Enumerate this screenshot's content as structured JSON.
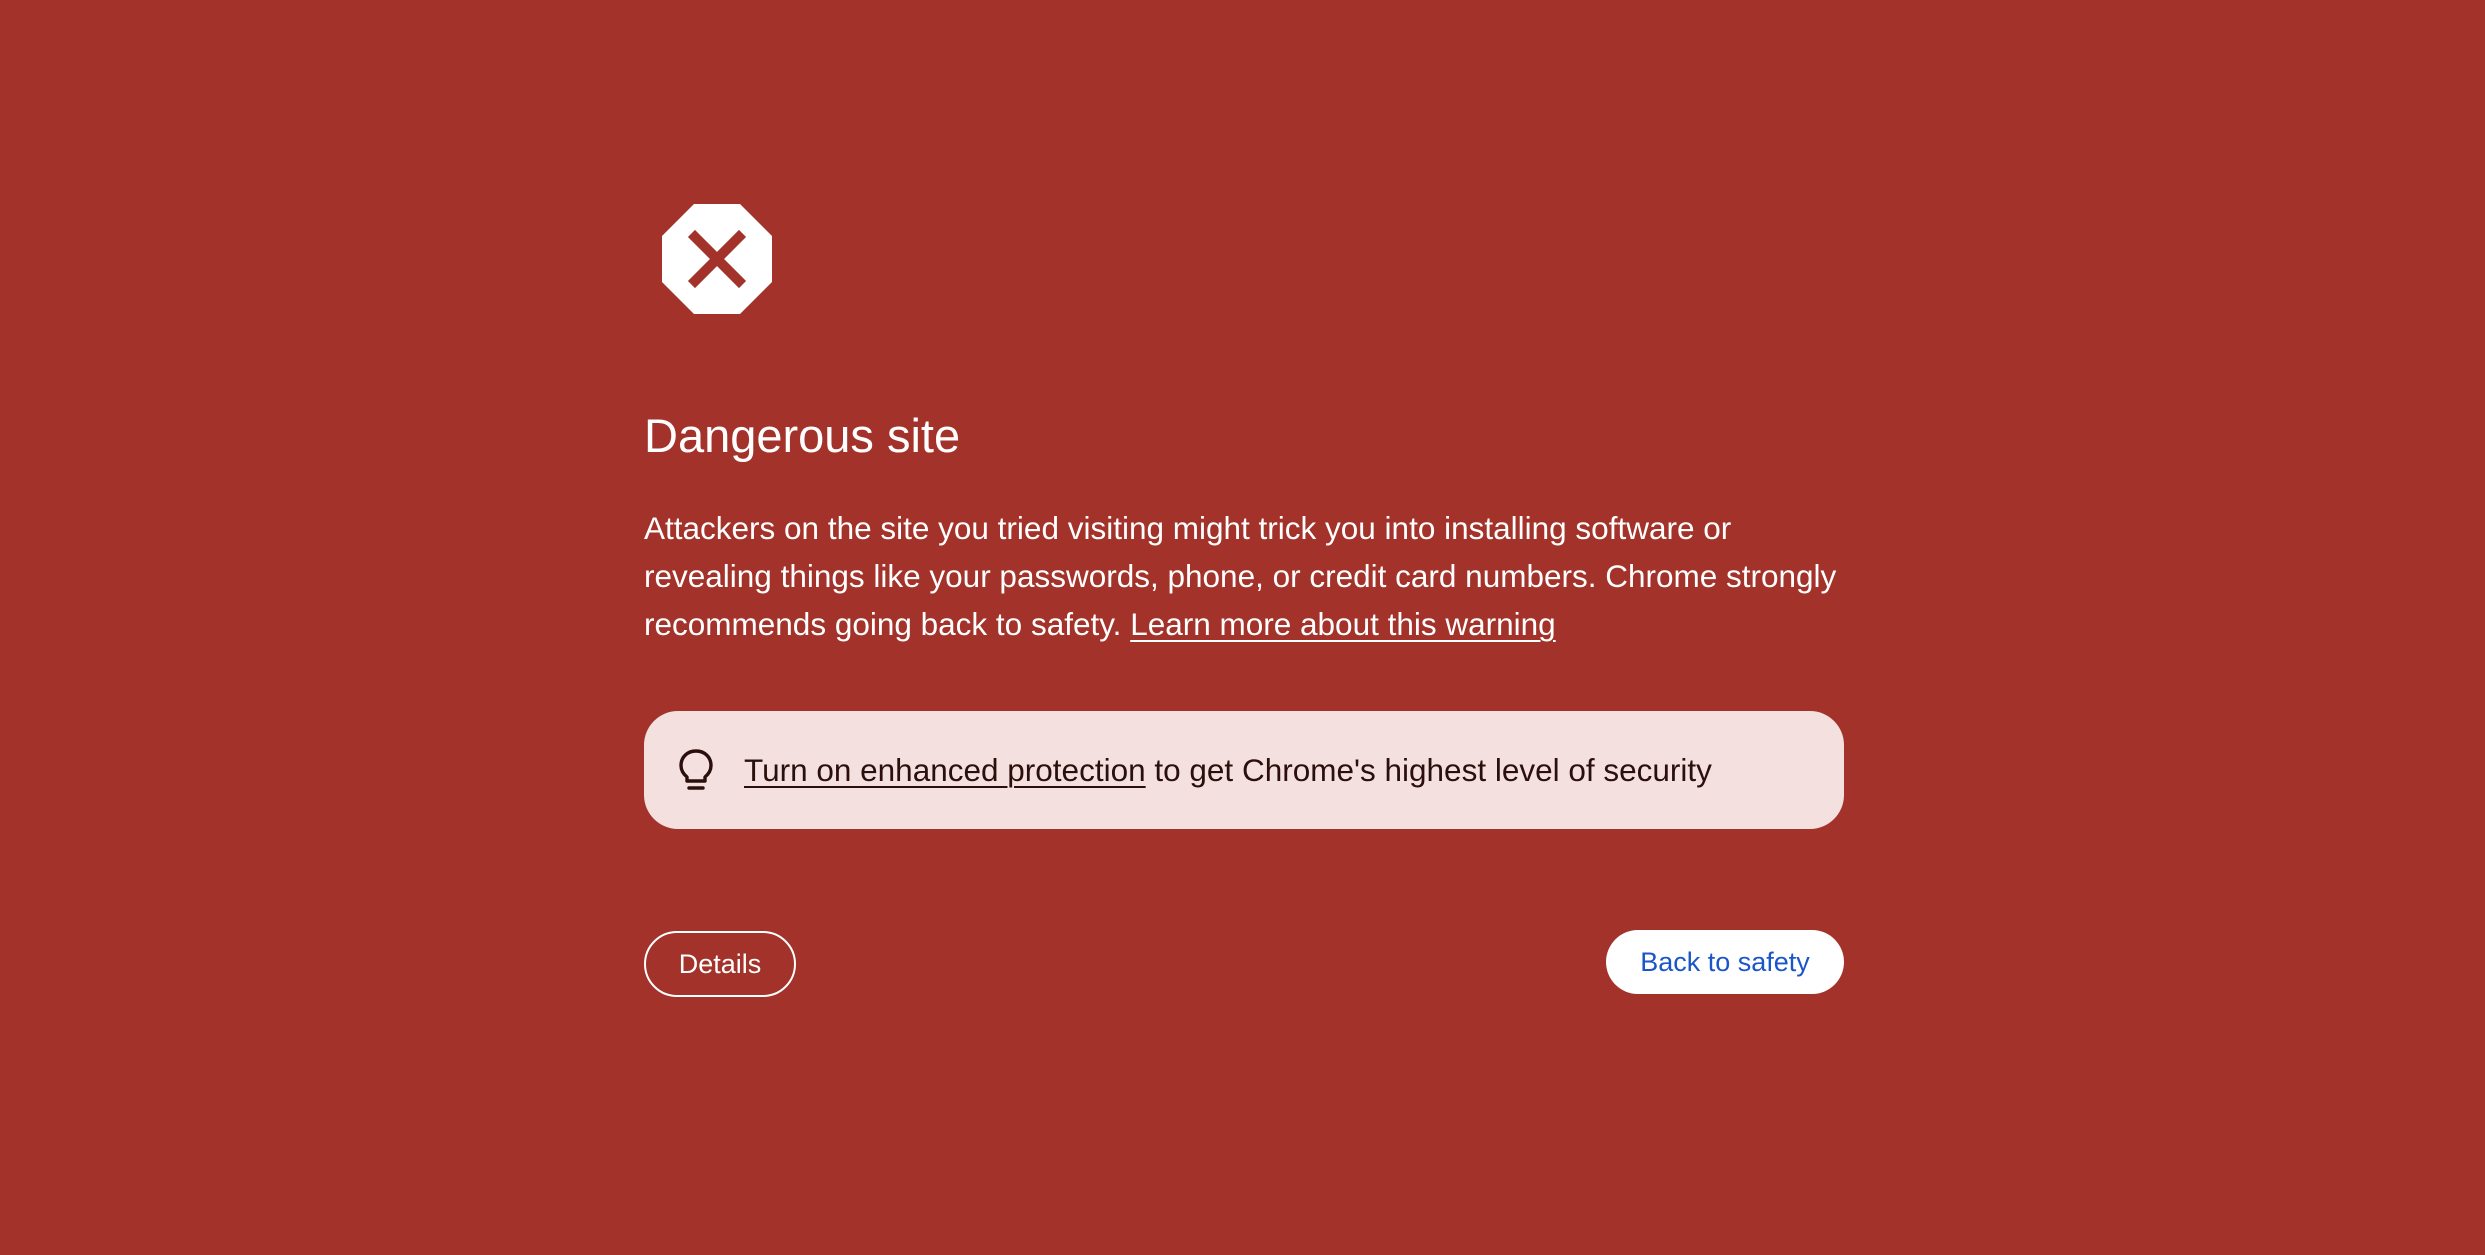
{
  "page": {
    "background_color": "#a3332a",
    "icon": "danger-octagon-x-icon",
    "title": "Dangerous site",
    "body": {
      "text": "Attackers on the site you tried visiting might trick you into installing software or revealing things like your passwords, phone, or credit card numbers. Chrome strongly recommends going back to safety.",
      "link_label": "Learn more about this warning"
    },
    "protection_banner": {
      "icon": "lightbulb-icon",
      "link_label": "Turn on enhanced protection",
      "text": " to get Chrome's highest level of security",
      "background_color": "#f4e0de"
    },
    "buttons": {
      "details_label": "Details",
      "back_label": "Back to safety",
      "back_text_color": "#1a56c8"
    }
  }
}
